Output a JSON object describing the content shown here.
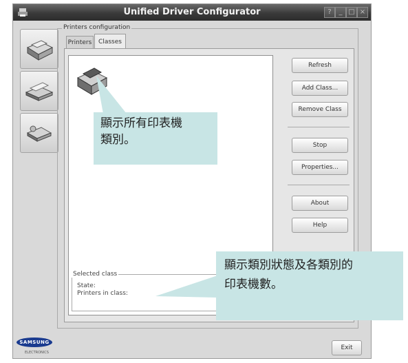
{
  "window": {
    "title": "Unified Driver Configurator",
    "controls": [
      "?",
      "_",
      "□",
      "×"
    ]
  },
  "sidebar": {
    "items": [
      {
        "name": "printers-configuration",
        "icon": "printer-icon"
      },
      {
        "name": "scanners-configuration",
        "icon": "scanner-icon"
      },
      {
        "name": "ports-configuration",
        "icon": "port-icon"
      }
    ]
  },
  "group": {
    "label": "Printers configuration"
  },
  "tabs": [
    {
      "label": "Printers",
      "active": false
    },
    {
      "label": "Classes",
      "active": true
    }
  ],
  "buttons": {
    "refresh": "Refresh",
    "add_class": "Add Class...",
    "remove_class": "Remove Class",
    "stop": "Stop",
    "properties": "Properties...",
    "about": "About",
    "help": "Help",
    "exit": "Exit"
  },
  "selected_class": {
    "title": "Selected class",
    "state_label": "State:",
    "printers_label": "Printers in class:"
  },
  "brand": {
    "logo": "SAMSUNG",
    "sub": "ELECTRONICS"
  },
  "callouts": {
    "list_line1": "顯示所有印表機",
    "list_line2": "類別。",
    "status_line1": "顯示類別狀態及各類別的",
    "status_line2": "印表機數。"
  },
  "colors": {
    "callout": "#c8e5e5",
    "titlebar": "#3a3a3a"
  }
}
